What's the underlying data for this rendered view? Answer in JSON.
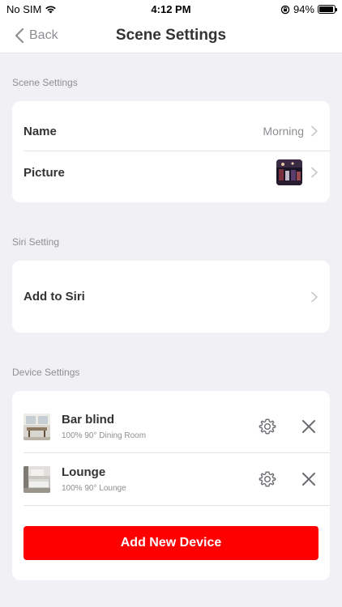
{
  "status_bar": {
    "carrier": "No SIM",
    "time": "4:12 PM",
    "battery_percent": "94%",
    "battery_level": 0.94
  },
  "nav": {
    "back_label": "Back",
    "title": "Scene Settings"
  },
  "sections": {
    "scene_settings": {
      "label": "Scene Settings",
      "name_label": "Name",
      "name_value": "Morning",
      "picture_label": "Picture"
    },
    "siri_setting": {
      "label": "Siri Setting",
      "add_label": "Add to Siri"
    },
    "device_settings": {
      "label": "Device Settings",
      "devices": [
        {
          "name": "Bar blind",
          "detail": "100% 90° Dining Room"
        },
        {
          "name": "Lounge",
          "detail": "100% 90° Lounge"
        }
      ],
      "add_button_label": "Add New Device"
    }
  },
  "colors": {
    "accent": "#ff0000",
    "background": "#f1f1f5",
    "secondary_text": "#8e8e93"
  },
  "icons": [
    "wifi-icon",
    "lock-rotation-icon",
    "battery-icon",
    "chevron-left-icon",
    "chevron-right-icon",
    "gear-icon",
    "close-icon"
  ]
}
